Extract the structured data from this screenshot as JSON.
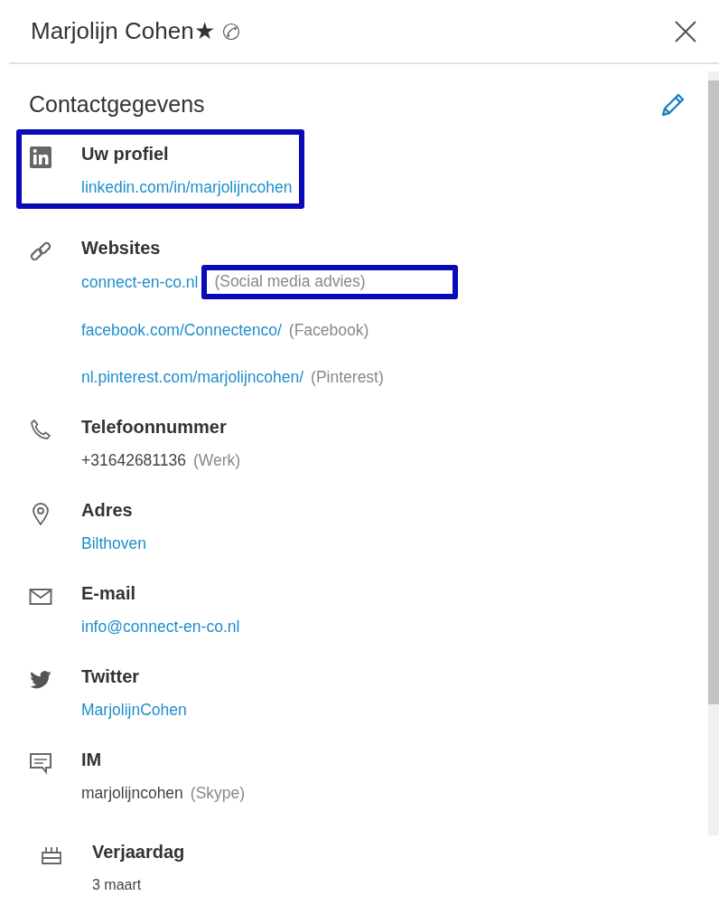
{
  "header": {
    "name": "Marjolijn Cohen★"
  },
  "section_title": "Contactgegevens",
  "sections": [
    {
      "kind": "linkedin",
      "title": "Uw profiel",
      "highlighted": true,
      "entries": [
        {
          "value": "linkedin.com/in/marjolijncohen",
          "link": true,
          "highlighted": false
        }
      ]
    },
    {
      "kind": "websites",
      "title": "Websites",
      "highlighted": false,
      "entries": [
        {
          "value": "connect-en-co.nl",
          "note": "(Social media advies)",
          "link": true,
          "highlighted": true
        },
        {
          "value": "facebook.com/Connectenco/",
          "note": "(Facebook)",
          "link": true,
          "highlighted": false
        },
        {
          "value": "nl.pinterest.com/marjolijncohen/",
          "note": "(Pinterest)",
          "link": true,
          "highlighted": false
        }
      ]
    },
    {
      "kind": "phone",
      "title": "Telefoonnummer",
      "highlighted": false,
      "entries": [
        {
          "value": "+31642681136",
          "note": "(Werk)",
          "link": false,
          "highlighted": false
        }
      ]
    },
    {
      "kind": "address",
      "title": "Adres",
      "highlighted": false,
      "entries": [
        {
          "value": "Bilthoven",
          "link": true,
          "highlighted": false
        }
      ]
    },
    {
      "kind": "email",
      "title": "E-mail",
      "highlighted": false,
      "entries": [
        {
          "value": "info@connect-en-co.nl",
          "link": true,
          "highlighted": false
        }
      ]
    },
    {
      "kind": "twitter",
      "title": "Twitter",
      "highlighted": false,
      "entries": [
        {
          "value": "MarjolijnCohen",
          "link": true,
          "highlighted": false
        }
      ]
    },
    {
      "kind": "im",
      "title": "IM",
      "highlighted": false,
      "entries": [
        {
          "value": "marjolijncohen",
          "note": "(Skype)",
          "link": false,
          "highlighted": false
        }
      ]
    }
  ],
  "birthday": {
    "title": "Verjaardag",
    "value": "3 maart"
  }
}
